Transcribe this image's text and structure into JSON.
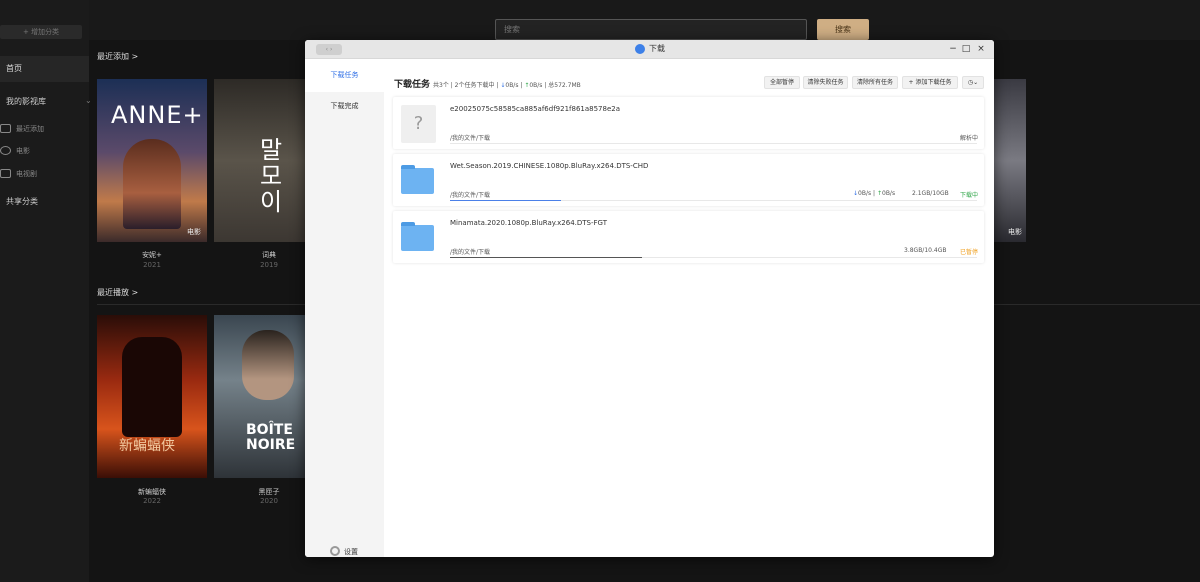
{
  "sidebar": {
    "add_category": "+ 增加分类",
    "home": "首页",
    "library": "我的影视库",
    "library_items": [
      "最近添加",
      "电影",
      "电视剧"
    ],
    "shared": "共享分类"
  },
  "topbar": {
    "search_placeholder": "搜索",
    "search_button": "搜索"
  },
  "sections": {
    "recent_added": "最近添加 >",
    "recent_played": "最近播放 >"
  },
  "posters_added": [
    {
      "title": "安妮+",
      "year": "2021",
      "tag": "电影",
      "art_text": "ANNE+"
    },
    {
      "title": "词典",
      "year": "2019",
      "art_text": "말\n모\n이"
    }
  ],
  "poster_right_tag": "电影",
  "posters_played": [
    {
      "title": "新蝙蝠侠",
      "year": "2022",
      "art_text": "新蝙蝠侠"
    },
    {
      "title": "黑匣子",
      "year": "2020",
      "art_text": "BOÎTE NOIRE"
    }
  ],
  "dialog": {
    "title": "下载",
    "nav": [
      "下载任务",
      "下载完成"
    ],
    "settings": "设置",
    "header": {
      "title": "下载任务",
      "total": "共3个",
      "downloading": "2个任务下载中",
      "down_speed": "0B/s",
      "up_speed": "0B/s",
      "total_size": "总572.7MB"
    },
    "buttons": [
      "全部暂停",
      "清除失败任务",
      "清除所有任务",
      "+ 添加下载任务"
    ],
    "tasks": [
      {
        "name": "e20025075c58585ca885af6df921f861a8578e2a",
        "path": "/我的文件/下载",
        "status": "解析中",
        "progress": 0
      },
      {
        "name": "Wet.Season.2019.CHINESE.1080p.BluRay.x264.DTS-CHD",
        "path": "/我的文件/下载",
        "down": "0B/s",
        "up": "0B/s",
        "size": "2.1GB/10GB",
        "status": "下载中",
        "progress": 0.21
      },
      {
        "name": "Minamata.2020.1080p.BluRay.x264.DTS-FGT",
        "path": "/我的文件/下载",
        "size": "3.8GB/10.4GB",
        "status": "已暂停",
        "progress": 0.365
      }
    ]
  },
  "colors": {
    "accent": "#2f6fe6",
    "downloading": "#31a64a",
    "paused": "#f0a020",
    "search_button": "#cfae84"
  }
}
